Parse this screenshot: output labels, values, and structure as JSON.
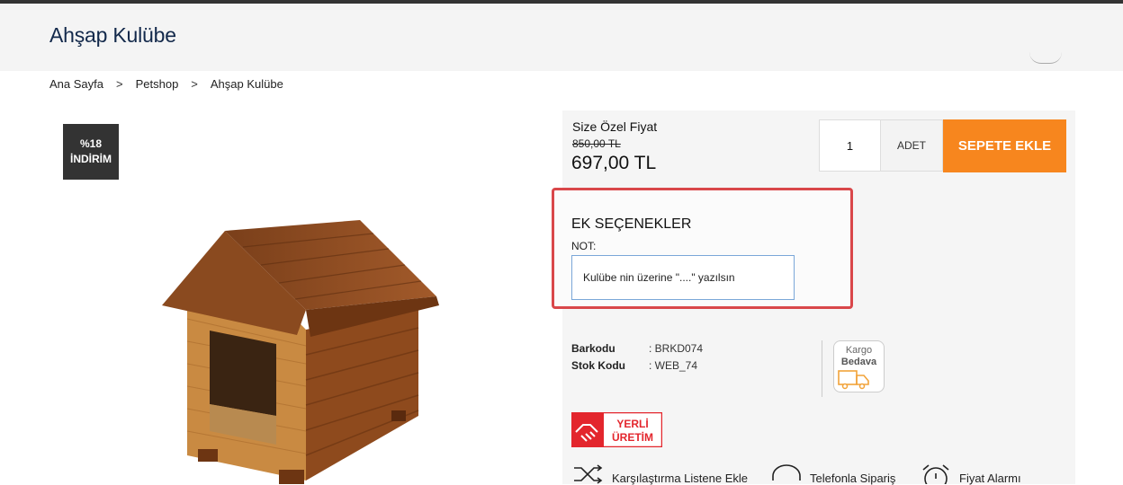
{
  "header": {
    "title": "Ahşap Kulübe"
  },
  "breadcrumb": {
    "items": [
      "Ana Sayfa",
      "Petshop",
      "Ahşap Kulübe"
    ],
    "separator": ">"
  },
  "badge": {
    "line1": "%18",
    "line2": "İNDİRİM"
  },
  "price": {
    "label": "Size Özel Fiyat",
    "old": "850,00 TL",
    "new": "697,00 TL"
  },
  "cart": {
    "quantity": "1",
    "unit": "ADET",
    "button": "SEPETE EKLE",
    "button_color": "#f7861e"
  },
  "options": {
    "title": "EK SEÇENEKLER",
    "note_label": "NOT:",
    "note_value": "Kulübe nin üzerine \"....\" yazılsın",
    "highlight_color": "#d9474a"
  },
  "meta": {
    "barcode_label": "Barkodu",
    "barcode_value": ": BRKD074",
    "stock_label": "Stok Kodu",
    "stock_value": ": WEB_74"
  },
  "kargo": {
    "line1": "Kargo",
    "line2": "Bedava",
    "icon": "truck-icon"
  },
  "yerli": {
    "line1": "YERLİ",
    "line2": "ÜRETİM",
    "icon": "handshake-icon",
    "color": "#e3262d"
  },
  "actions": {
    "compare": "Karşılaştırma Listene Ekle",
    "phone": "Telefonla Sipariş",
    "alarm": "Fiyat Alarmı"
  }
}
